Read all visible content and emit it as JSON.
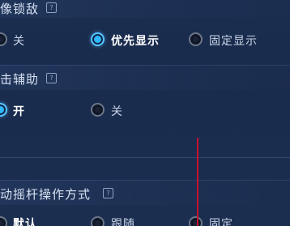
{
  "sections": [
    {
      "title": "头像锁敌",
      "info_icon": "?",
      "options": [
        {
          "label": "关",
          "selected": false
        },
        {
          "label": "优先显示",
          "selected": true
        },
        {
          "label": "固定显示",
          "selected": false
        }
      ]
    },
    {
      "title": "攻击辅助",
      "info_icon": "?",
      "options": [
        {
          "label": "开",
          "selected": true
        },
        {
          "label": "关",
          "selected": false
        }
      ]
    },
    {
      "title": "移动摇杆操作方式",
      "info_icon": "?",
      "options": [
        {
          "label": "默认",
          "selected": false
        },
        {
          "label": "跟随",
          "selected": false
        },
        {
          "label": "固定",
          "selected": false
        }
      ]
    }
  ],
  "colors": {
    "background": "#1b2d4f",
    "selected_radio": "#2fb8ff",
    "annotation_line": "#c8102e"
  }
}
